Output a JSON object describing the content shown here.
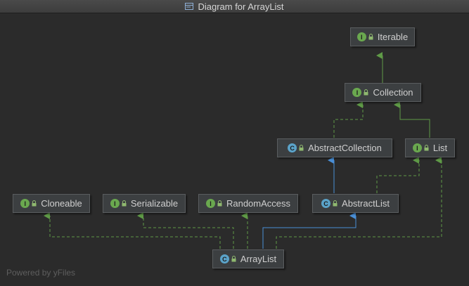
{
  "window": {
    "title": "Diagram for ArrayList"
  },
  "nodes": {
    "iterable": {
      "label": "Iterable",
      "kind": "I"
    },
    "collection": {
      "label": "Collection",
      "kind": "I"
    },
    "abstract_collection": {
      "label": "AbstractCollection",
      "kind": "C"
    },
    "list": {
      "label": "List",
      "kind": "I"
    },
    "cloneable": {
      "label": "Cloneable",
      "kind": "I"
    },
    "serializable": {
      "label": "Serializable",
      "kind": "I"
    },
    "random_access": {
      "label": "RandomAccess",
      "kind": "I"
    },
    "abstract_list": {
      "label": "AbstractList",
      "kind": "C"
    },
    "array_list": {
      "label": "ArrayList",
      "kind": "C"
    }
  },
  "footer": {
    "text": "Powered by yFiles"
  },
  "colors": {
    "background": "#2b2b2b",
    "node_fill": "#3c3f41",
    "interface_badge": "#6aa84f",
    "class_badge": "#5ba3c9",
    "implements_edge": "#5f9a47",
    "extends_edge": "#4a8fd6"
  },
  "icons": {
    "title": "class-diagram-icon",
    "visibility": "lock-icon"
  }
}
